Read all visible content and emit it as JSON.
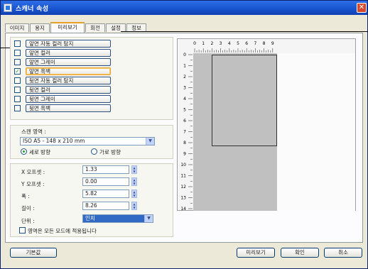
{
  "window": {
    "title": "스캐너 속성"
  },
  "tabs": [
    {
      "label": "이미지"
    },
    {
      "label": "용지"
    },
    {
      "label": "미리보기"
    },
    {
      "label": "회전"
    },
    {
      "label": "설정"
    },
    {
      "label": "정보"
    }
  ],
  "options": [
    {
      "label": "앞면 자동 컬러 탐지",
      "checked": false
    },
    {
      "label": "앞면 컬러",
      "checked": false
    },
    {
      "label": "앞면 그레이",
      "checked": false
    },
    {
      "label": "앞면 흑백",
      "checked": true
    },
    {
      "label": "뒷면 자동 컬러 탐지",
      "checked": false
    },
    {
      "label": "뒷면 컬러",
      "checked": false
    },
    {
      "label": "뒷면 그레이",
      "checked": false
    },
    {
      "label": "뒷면 흑백",
      "checked": false
    }
  ],
  "scan_area": {
    "label": "스캔 영역 :",
    "value": "ISO A5 - 148 x 210 mm",
    "portrait_label": "세로 방향",
    "landscape_label": "가로 방향",
    "orientation": "portrait"
  },
  "fields": {
    "x_offset": {
      "label": "X 오프셋 :",
      "value": "1.33"
    },
    "y_offset": {
      "label": "Y 오프셋 :",
      "value": "0.00"
    },
    "width": {
      "label": "폭 :",
      "value": "5.82"
    },
    "length": {
      "label": "길이 :",
      "value": "8.26"
    },
    "unit": {
      "label": "단위 :",
      "value": "인치"
    }
  },
  "apply_all": {
    "label": "영역은 모든 모드에 적용됩니다",
    "checked": false
  },
  "ruler": {
    "top_ticks": [
      "0",
      "1",
      "2",
      "3",
      "4",
      "5",
      "6",
      "7",
      "8",
      "9"
    ],
    "left_ticks": [
      "0",
      "1",
      "2",
      "3",
      "4",
      "5",
      "6",
      "7",
      "8",
      "9",
      "10",
      "11",
      "12",
      "13",
      "14"
    ]
  },
  "buttons": {
    "default": "기본값",
    "preview": "미리보기",
    "ok": "확인",
    "cancel": "취소"
  },
  "colors": {
    "title_bar": "#1853cf",
    "focus_orange": "#e8a02a",
    "check_green": "#21a121",
    "selection_blue": "#316ac5"
  }
}
